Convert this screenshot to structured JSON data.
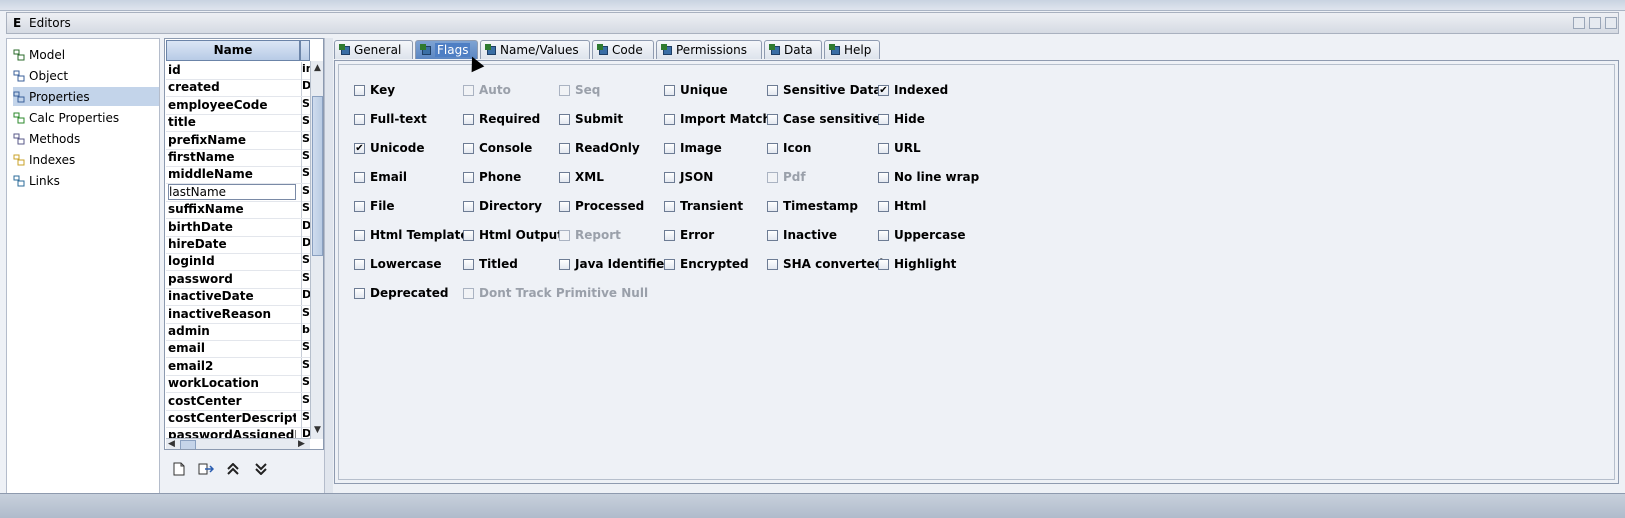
{
  "window": {
    "title": "Editors",
    "app_icon": "E"
  },
  "nav": {
    "items": [
      {
        "label": "Model",
        "icon": "model-icon"
      },
      {
        "label": "Object",
        "icon": "object-icon"
      },
      {
        "label": "Properties",
        "icon": "properties-icon",
        "selected": true
      },
      {
        "label": "Calc Properties",
        "icon": "calc-properties-icon"
      },
      {
        "label": "Methods",
        "icon": "methods-icon"
      },
      {
        "label": "Indexes",
        "icon": "indexes-icon"
      },
      {
        "label": "Links",
        "icon": "links-icon"
      }
    ]
  },
  "props": {
    "header": "Name",
    "rows": [
      {
        "name": "id",
        "type": "in"
      },
      {
        "name": "created",
        "type": "D"
      },
      {
        "name": "employeeCode",
        "type": "S"
      },
      {
        "name": "title",
        "type": "S"
      },
      {
        "name": "prefixName",
        "type": "S"
      },
      {
        "name": "firstName",
        "type": "S"
      },
      {
        "name": "middleName",
        "type": "S"
      },
      {
        "name": "lastName",
        "type": "S"
      },
      {
        "name": "suffixName",
        "type": "S"
      },
      {
        "name": "birthDate",
        "type": "D"
      },
      {
        "name": "hireDate",
        "type": "D"
      },
      {
        "name": "loginId",
        "type": "S"
      },
      {
        "name": "password",
        "type": "S"
      },
      {
        "name": "inactiveDate",
        "type": "D"
      },
      {
        "name": "inactiveReason",
        "type": "S"
      },
      {
        "name": "admin",
        "type": "b"
      },
      {
        "name": "email",
        "type": "S"
      },
      {
        "name": "email2",
        "type": "S"
      },
      {
        "name": "workLocation",
        "type": "S"
      },
      {
        "name": "costCenter",
        "type": "S"
      },
      {
        "name": "costCenterDescription",
        "type": "S"
      },
      {
        "name": "passwordAssignedD...",
        "type": "D"
      }
    ]
  },
  "tabs": [
    {
      "label": "General"
    },
    {
      "label": "Flags",
      "active": true
    },
    {
      "label": "Name/Values"
    },
    {
      "label": "Code"
    },
    {
      "label": "Permissions"
    },
    {
      "label": "Data"
    },
    {
      "label": "Help"
    }
  ],
  "flags": [
    {
      "label": "Key",
      "checked": false,
      "disabled": false
    },
    {
      "label": "Auto",
      "checked": false,
      "disabled": true
    },
    {
      "label": "Seq",
      "checked": false,
      "disabled": true
    },
    {
      "label": "Unique",
      "checked": false,
      "disabled": false
    },
    {
      "label": "Sensitive Data",
      "checked": false,
      "disabled": false
    },
    {
      "label": "Indexed",
      "checked": true,
      "disabled": false
    },
    {
      "label": "Full-text",
      "checked": false,
      "disabled": false
    },
    {
      "label": "Required",
      "checked": false,
      "disabled": false
    },
    {
      "label": "Submit",
      "checked": false,
      "disabled": false
    },
    {
      "label": "Import Match",
      "checked": false,
      "disabled": false
    },
    {
      "label": "Case sensitive",
      "checked": false,
      "disabled": false
    },
    {
      "label": "Hide",
      "checked": false,
      "disabled": false
    },
    {
      "label": "Unicode",
      "checked": true,
      "disabled": false
    },
    {
      "label": "Console",
      "checked": false,
      "disabled": false
    },
    {
      "label": "ReadOnly",
      "checked": false,
      "disabled": false
    },
    {
      "label": "Image",
      "checked": false,
      "disabled": false
    },
    {
      "label": "Icon",
      "checked": false,
      "disabled": false
    },
    {
      "label": "URL",
      "checked": false,
      "disabled": false
    },
    {
      "label": "Email",
      "checked": false,
      "disabled": false
    },
    {
      "label": "Phone",
      "checked": false,
      "disabled": false
    },
    {
      "label": "XML",
      "checked": false,
      "disabled": false
    },
    {
      "label": "JSON",
      "checked": false,
      "disabled": false
    },
    {
      "label": "Pdf",
      "checked": false,
      "disabled": true
    },
    {
      "label": "No line wrap",
      "checked": false,
      "disabled": false
    },
    {
      "label": "File",
      "checked": false,
      "disabled": false
    },
    {
      "label": "Directory",
      "checked": false,
      "disabled": false
    },
    {
      "label": "Processed",
      "checked": false,
      "disabled": false
    },
    {
      "label": "Transient",
      "checked": false,
      "disabled": false
    },
    {
      "label": "Timestamp",
      "checked": false,
      "disabled": false
    },
    {
      "label": "Html",
      "checked": false,
      "disabled": false
    },
    {
      "label": "Html Template",
      "checked": false,
      "disabled": false
    },
    {
      "label": "Html Output",
      "checked": false,
      "disabled": false
    },
    {
      "label": "Report",
      "checked": false,
      "disabled": true
    },
    {
      "label": "Error",
      "checked": false,
      "disabled": false
    },
    {
      "label": "Inactive",
      "checked": false,
      "disabled": false
    },
    {
      "label": "Uppercase",
      "checked": false,
      "disabled": false
    },
    {
      "label": "Lowercase",
      "checked": false,
      "disabled": false
    },
    {
      "label": "Titled",
      "checked": false,
      "disabled": false
    },
    {
      "label": "Java Identifier",
      "checked": false,
      "disabled": false
    },
    {
      "label": "Encrypted",
      "checked": false,
      "disabled": false
    },
    {
      "label": "SHA converted",
      "checked": false,
      "disabled": false
    },
    {
      "label": "Highlight",
      "checked": false,
      "disabled": false
    },
    {
      "label": "Deprecated",
      "checked": false,
      "disabled": false
    },
    {
      "label": "Dont Track Primitive Null",
      "checked": false,
      "disabled": true
    }
  ],
  "colors": {
    "selection": "#c3d4ea",
    "active_tab": "#5b86c2"
  }
}
